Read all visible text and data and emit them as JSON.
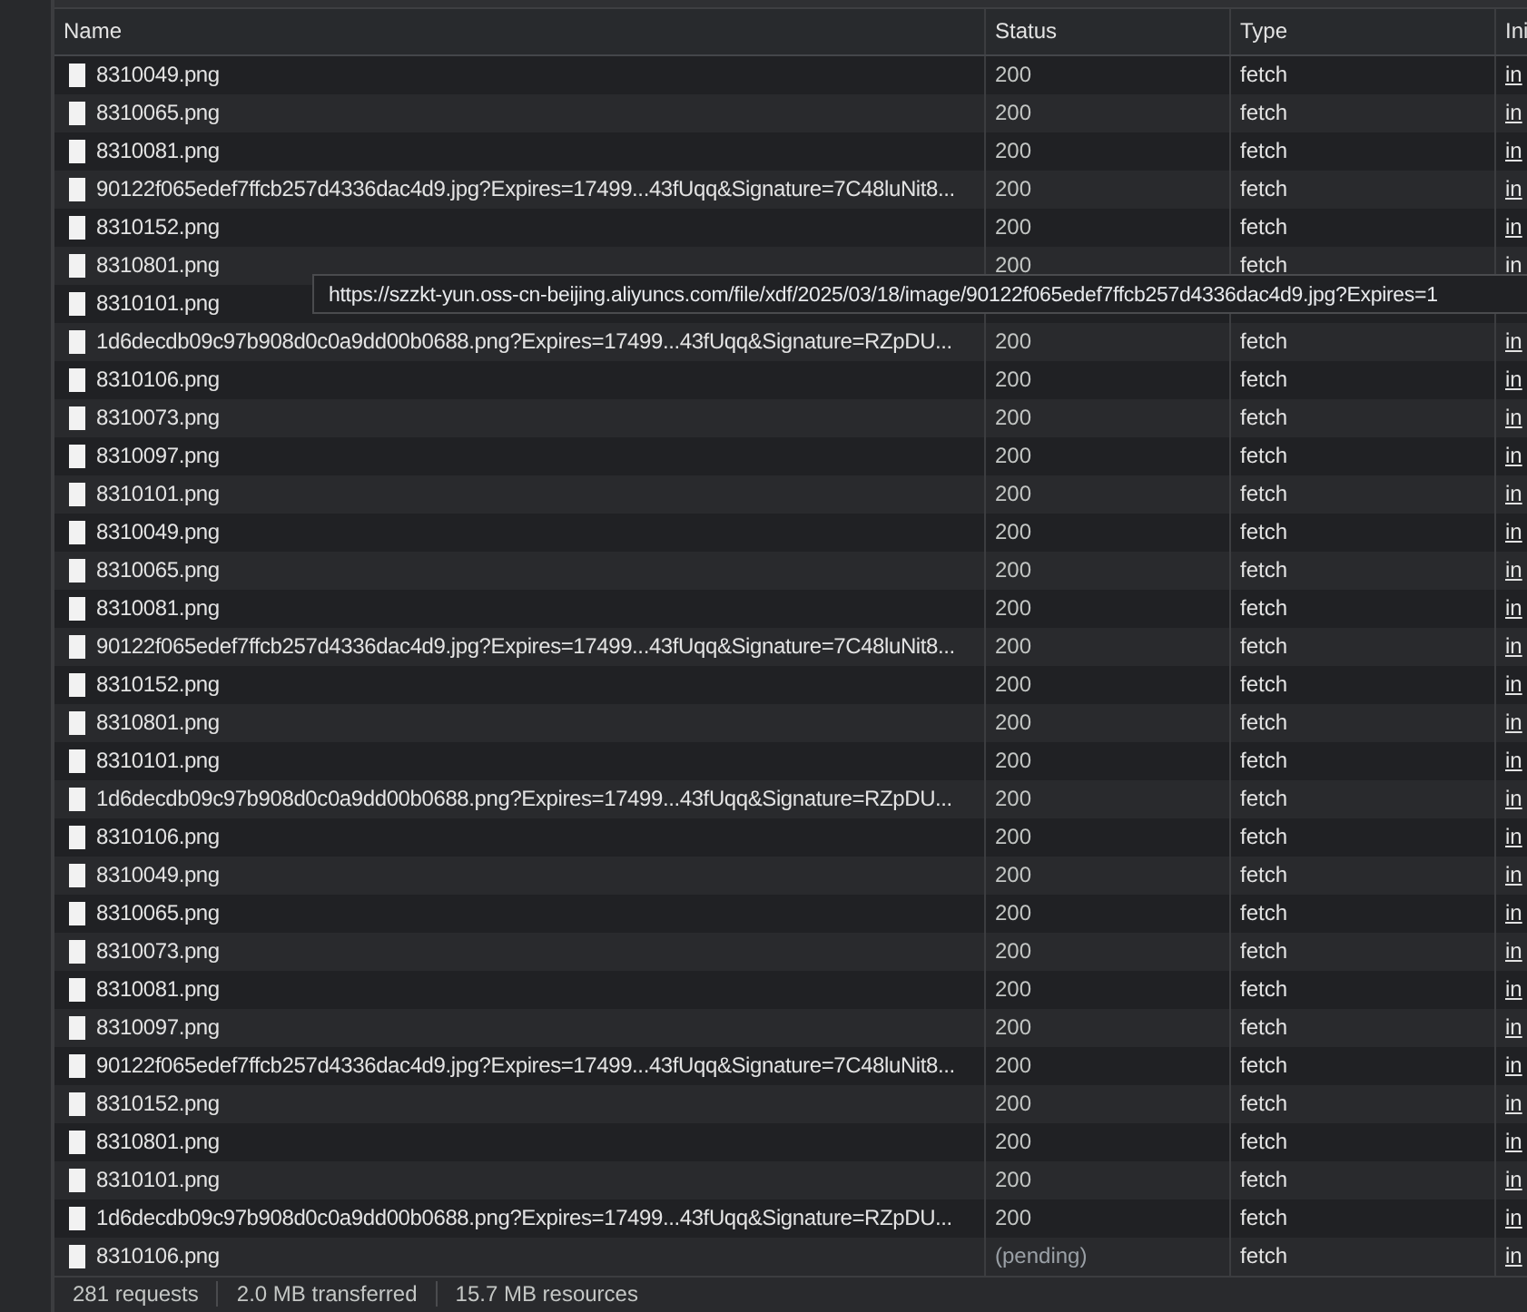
{
  "table": {
    "columns": [
      "Name",
      "Status",
      "Type",
      "Ini"
    ],
    "rows": [
      {
        "name": "8310049.png",
        "status": "200",
        "type": "fetch",
        "initiator": "in"
      },
      {
        "name": "8310065.png",
        "status": "200",
        "type": "fetch",
        "initiator": "in"
      },
      {
        "name": "8310081.png",
        "status": "200",
        "type": "fetch",
        "initiator": "in"
      },
      {
        "name": "90122f065edef7ffcb257d4336dac4d9.jpg?Expires=17499...43fUqq&Signature=7C48luNit8...",
        "status": "200",
        "type": "fetch",
        "initiator": "in"
      },
      {
        "name": "8310152.png",
        "status": "200",
        "type": "fetch",
        "initiator": "in"
      },
      {
        "name": "8310801.png",
        "status": "200",
        "type": "fetch",
        "initiator": "in"
      },
      {
        "name": "8310101.png"
      },
      {
        "name": "1d6decdb09c97b908d0c0a9dd00b0688.png?Expires=17499...43fUqq&Signature=RZpDU...",
        "status": "200",
        "type": "fetch",
        "initiator": "in"
      },
      {
        "name": "8310106.png",
        "status": "200",
        "type": "fetch",
        "initiator": "in"
      },
      {
        "name": "8310073.png",
        "status": "200",
        "type": "fetch",
        "initiator": "in"
      },
      {
        "name": "8310097.png",
        "status": "200",
        "type": "fetch",
        "initiator": "in"
      },
      {
        "name": "8310101.png",
        "status": "200",
        "type": "fetch",
        "initiator": "in"
      },
      {
        "name": "8310049.png",
        "status": "200",
        "type": "fetch",
        "initiator": "in"
      },
      {
        "name": "8310065.png",
        "status": "200",
        "type": "fetch",
        "initiator": "in"
      },
      {
        "name": "8310081.png",
        "status": "200",
        "type": "fetch",
        "initiator": "in"
      },
      {
        "name": "90122f065edef7ffcb257d4336dac4d9.jpg?Expires=17499...43fUqq&Signature=7C48luNit8...",
        "status": "200",
        "type": "fetch",
        "initiator": "in"
      },
      {
        "name": "8310152.png",
        "status": "200",
        "type": "fetch",
        "initiator": "in"
      },
      {
        "name": "8310801.png",
        "status": "200",
        "type": "fetch",
        "initiator": "in"
      },
      {
        "name": "8310101.png",
        "status": "200",
        "type": "fetch",
        "initiator": "in"
      },
      {
        "name": "1d6decdb09c97b908d0c0a9dd00b0688.png?Expires=17499...43fUqq&Signature=RZpDU...",
        "status": "200",
        "type": "fetch",
        "initiator": "in"
      },
      {
        "name": "8310106.png",
        "status": "200",
        "type": "fetch",
        "initiator": "in"
      },
      {
        "name": "8310049.png",
        "status": "200",
        "type": "fetch",
        "initiator": "in"
      },
      {
        "name": "8310065.png",
        "status": "200",
        "type": "fetch",
        "initiator": "in"
      },
      {
        "name": "8310073.png",
        "status": "200",
        "type": "fetch",
        "initiator": "in"
      },
      {
        "name": "8310081.png",
        "status": "200",
        "type": "fetch",
        "initiator": "in"
      },
      {
        "name": "8310097.png",
        "status": "200",
        "type": "fetch",
        "initiator": "in"
      },
      {
        "name": "90122f065edef7ffcb257d4336dac4d9.jpg?Expires=17499...43fUqq&Signature=7C48luNit8...",
        "status": "200",
        "type": "fetch",
        "initiator": "in"
      },
      {
        "name": "8310152.png",
        "status": "200",
        "type": "fetch",
        "initiator": "in"
      },
      {
        "name": "8310801.png",
        "status": "200",
        "type": "fetch",
        "initiator": "in"
      },
      {
        "name": "8310101.png",
        "status": "200",
        "type": "fetch",
        "initiator": "in"
      },
      {
        "name": "1d6decdb09c97b908d0c0a9dd00b0688.png?Expires=17499...43fUqq&Signature=RZpDU...",
        "status": "200",
        "type": "fetch",
        "initiator": "in"
      },
      {
        "name": "8310106.png",
        "status": "(pending)",
        "type": "fetch",
        "initiator": "in"
      }
    ]
  },
  "tooltip": {
    "text": "https://szzkt-yun.oss-cn-beijing.aliyuncs.com/file/xdf/2025/03/18/image/90122f065edef7ffcb257d4336dac4d9.jpg?Expires=1"
  },
  "status_bar": [
    "281 requests",
    "2.0 MB transferred",
    "15.7 MB resources"
  ]
}
